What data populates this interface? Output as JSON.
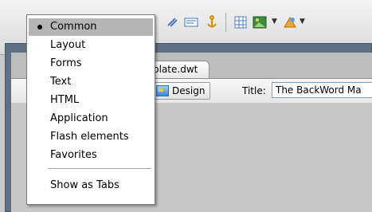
{
  "menu": {
    "items": [
      {
        "label": "Common",
        "selected": true
      },
      {
        "label": "Layout"
      },
      {
        "label": "Forms"
      },
      {
        "label": "Text"
      },
      {
        "label": "HTML"
      },
      {
        "label": "Application"
      },
      {
        "label": "Flash elements"
      },
      {
        "label": "Favorites"
      }
    ],
    "show_as_tabs": "Show as Tabs"
  },
  "document": {
    "tab_label": "plate.dwt",
    "design_button": "Design",
    "title_label": "Title:",
    "title_value": "The BackWord Ma"
  },
  "toolbar_icons": [
    "attach-icon",
    "email-icon",
    "anchor-icon",
    "table-icon",
    "image-icon",
    "media-icon"
  ]
}
